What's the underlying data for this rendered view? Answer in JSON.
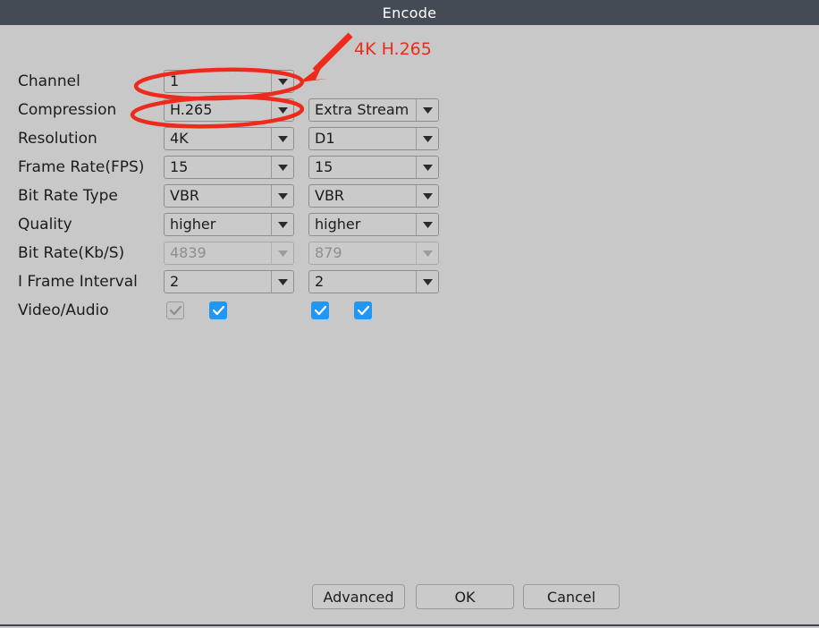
{
  "window": {
    "title": "Encode"
  },
  "form": {
    "rows": [
      {
        "label": "Channel",
        "main": {
          "value": "1",
          "disabled": false
        },
        "extra": null
      },
      {
        "label": "Compression",
        "main": {
          "value": "H.265",
          "disabled": false
        },
        "extra": {
          "value": "Extra Stream",
          "disabled": false
        }
      },
      {
        "label": "Resolution",
        "main": {
          "value": "4K",
          "disabled": false
        },
        "extra": {
          "value": "D1",
          "disabled": false
        }
      },
      {
        "label": "Frame Rate(FPS)",
        "main": {
          "value": "15",
          "disabled": false
        },
        "extra": {
          "value": "15",
          "disabled": false
        }
      },
      {
        "label": "Bit Rate Type",
        "main": {
          "value": "VBR",
          "disabled": false
        },
        "extra": {
          "value": "VBR",
          "disabled": false
        }
      },
      {
        "label": "Quality",
        "main": {
          "value": "higher",
          "disabled": false
        },
        "extra": {
          "value": "higher",
          "disabled": false
        }
      },
      {
        "label": "Bit Rate(Kb/S)",
        "main": {
          "value": "4839",
          "disabled": true
        },
        "extra": {
          "value": "879",
          "disabled": true
        }
      },
      {
        "label": "I Frame Interval",
        "main": {
          "value": "2",
          "disabled": false
        },
        "extra": {
          "value": "2",
          "disabled": false
        }
      },
      {
        "label": "Video/Audio",
        "main": null,
        "extra": null
      }
    ],
    "video_audio_checkboxes": [
      {
        "name": "main-video",
        "checked": true,
        "disabled": true
      },
      {
        "name": "main-audio",
        "checked": true,
        "disabled": false
      },
      {
        "name": "extra-video",
        "checked": true,
        "disabled": false
      },
      {
        "name": "extra-audio",
        "checked": true,
        "disabled": false
      }
    ]
  },
  "buttons": {
    "advanced": "Advanced",
    "ok": "OK",
    "cancel": "Cancel"
  },
  "annotations": {
    "callout_text": "4K H.265",
    "color": "#ee2a1d",
    "shapes": [
      {
        "type": "ellipse",
        "target": "compression-main-combo"
      },
      {
        "type": "ellipse",
        "target": "resolution-main-combo"
      },
      {
        "type": "arrow",
        "target": "compression-extra-combo"
      }
    ]
  },
  "colors": {
    "titlebar_bg": "#454b54",
    "titlebar_text": "#ffffff",
    "body_bg": "#c8c8c8",
    "control_bg": "#cacaca",
    "control_border": "#8d8d8d",
    "text": "#1b1b1b",
    "disabled_text": "#8e8e8e",
    "checkbox_checked": "#2196f3",
    "annotation_red": "#ee2a1d"
  }
}
